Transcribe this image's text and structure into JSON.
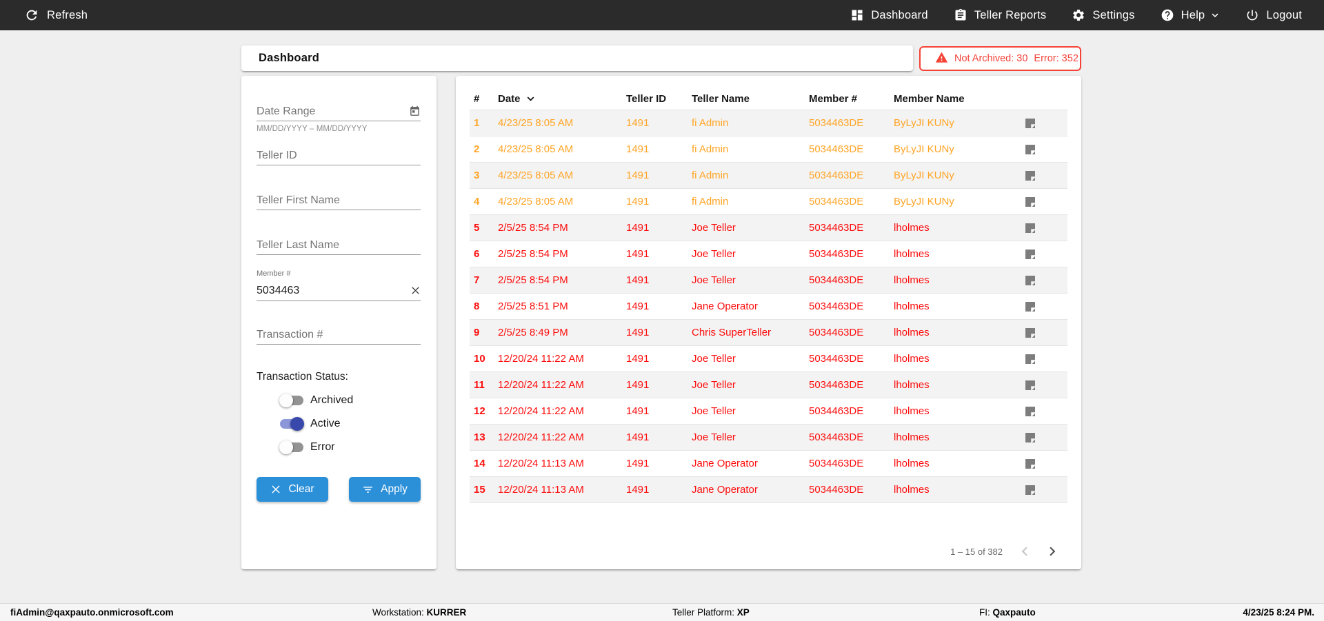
{
  "nav": {
    "refresh_label": "Refresh",
    "items": [
      {
        "label": "Dashboard"
      },
      {
        "label": "Teller Reports"
      },
      {
        "label": "Settings"
      },
      {
        "label": "Help"
      },
      {
        "label": "Logout"
      }
    ]
  },
  "header": {
    "title": "Dashboard",
    "alert": {
      "not_archived": "Not Archived: 30",
      "error": "Error: 352"
    }
  },
  "filters": {
    "date_range": {
      "placeholder": "Date Range",
      "hint": "MM/DD/YYYY – MM/DD/YYYY"
    },
    "teller_id": {
      "placeholder": "Teller ID"
    },
    "teller_first_name": {
      "placeholder": "Teller First Name"
    },
    "teller_last_name": {
      "placeholder": "Teller Last Name"
    },
    "member_number": {
      "label": "Member #",
      "value": "5034463"
    },
    "transaction_number": {
      "placeholder": "Transaction #"
    },
    "status": {
      "label": "Transaction Status:",
      "toggles": [
        {
          "label": "Archived",
          "on": false
        },
        {
          "label": "Active",
          "on": true
        },
        {
          "label": "Error",
          "on": false
        }
      ]
    },
    "clear_label": "Clear",
    "apply_label": "Apply"
  },
  "table": {
    "columns": [
      "#",
      "Date",
      "Teller ID",
      "Teller Name",
      "Member #",
      "Member Name"
    ],
    "sorted_column": "Date",
    "row_colors": {
      "warning": "#ffa424",
      "error": "#fd0d0d"
    },
    "rows": [
      {
        "num": "1",
        "date": "4/23/25 8:05 AM",
        "teller_id": "1491",
        "teller_name": "fi Admin",
        "member_num": "5034463DE",
        "member_name": "ByLyJI KUNy",
        "status": "warning"
      },
      {
        "num": "2",
        "date": "4/23/25 8:05 AM",
        "teller_id": "1491",
        "teller_name": "fi Admin",
        "member_num": "5034463DE",
        "member_name": "ByLyJI KUNy",
        "status": "warning"
      },
      {
        "num": "3",
        "date": "4/23/25 8:05 AM",
        "teller_id": "1491",
        "teller_name": "fi Admin",
        "member_num": "5034463DE",
        "member_name": "ByLyJI KUNy",
        "status": "warning"
      },
      {
        "num": "4",
        "date": "4/23/25 8:05 AM",
        "teller_id": "1491",
        "teller_name": "fi Admin",
        "member_num": "5034463DE",
        "member_name": "ByLyJI KUNy",
        "status": "warning"
      },
      {
        "num": "5",
        "date": "2/5/25 8:54 PM",
        "teller_id": "1491",
        "teller_name": "Joe Teller",
        "member_num": "5034463DE",
        "member_name": "lholmes",
        "status": "error"
      },
      {
        "num": "6",
        "date": "2/5/25 8:54 PM",
        "teller_id": "1491",
        "teller_name": "Joe Teller",
        "member_num": "5034463DE",
        "member_name": "lholmes",
        "status": "error"
      },
      {
        "num": "7",
        "date": "2/5/25 8:54 PM",
        "teller_id": "1491",
        "teller_name": "Joe Teller",
        "member_num": "5034463DE",
        "member_name": "lholmes",
        "status": "error"
      },
      {
        "num": "8",
        "date": "2/5/25 8:51 PM",
        "teller_id": "1491",
        "teller_name": "Jane Operator",
        "member_num": "5034463DE",
        "member_name": "lholmes",
        "status": "error"
      },
      {
        "num": "9",
        "date": "2/5/25 8:49 PM",
        "teller_id": "1491",
        "teller_name": "Chris SuperTeller",
        "member_num": "5034463DE",
        "member_name": "lholmes",
        "status": "error"
      },
      {
        "num": "10",
        "date": "12/20/24 11:22 AM",
        "teller_id": "1491",
        "teller_name": "Joe Teller",
        "member_num": "5034463DE",
        "member_name": "lholmes",
        "status": "error"
      },
      {
        "num": "11",
        "date": "12/20/24 11:22 AM",
        "teller_id": "1491",
        "teller_name": "Joe Teller",
        "member_num": "5034463DE",
        "member_name": "lholmes",
        "status": "error"
      },
      {
        "num": "12",
        "date": "12/20/24 11:22 AM",
        "teller_id": "1491",
        "teller_name": "Joe Teller",
        "member_num": "5034463DE",
        "member_name": "lholmes",
        "status": "error"
      },
      {
        "num": "13",
        "date": "12/20/24 11:22 AM",
        "teller_id": "1491",
        "teller_name": "Joe Teller",
        "member_num": "5034463DE",
        "member_name": "lholmes",
        "status": "error"
      },
      {
        "num": "14",
        "date": "12/20/24 11:13 AM",
        "teller_id": "1491",
        "teller_name": "Jane Operator",
        "member_num": "5034463DE",
        "member_name": "lholmes",
        "status": "error"
      },
      {
        "num": "15",
        "date": "12/20/24 11:13 AM",
        "teller_id": "1491",
        "teller_name": "Jane Operator",
        "member_num": "5034463DE",
        "member_name": "lholmes",
        "status": "error"
      }
    ]
  },
  "pagination": {
    "range_label": "1 – 15 of 382"
  },
  "footer": {
    "user": "fiAdmin@qaxpauto.onmicrosoft.com",
    "workstation_label": "Workstation: ",
    "workstation": "KURRER",
    "platform_label": "Teller Platform: ",
    "platform": "XP",
    "fi_label": "FI: ",
    "fi": "Qaxpauto",
    "timestamp": "4/23/25 8:24 PM."
  }
}
